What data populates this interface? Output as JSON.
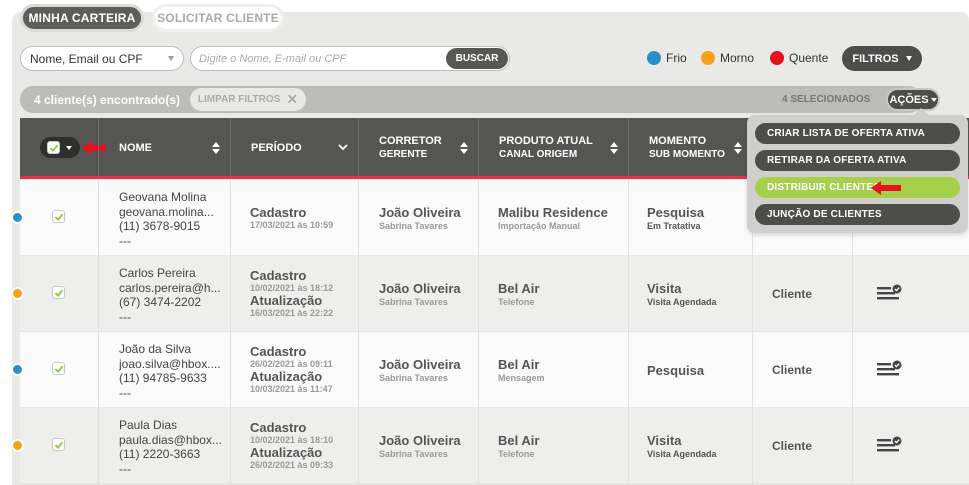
{
  "tabs": [
    {
      "label": "MINHA CARTEIRA",
      "active": true
    },
    {
      "label": "SOLICITAR CLIENTE",
      "active": false
    }
  ],
  "search": {
    "filter_select": "Nome, Email ou CPF",
    "placeholder": "Digite o Nome, E-mail ou CPF",
    "button_label": "BUSCAR"
  },
  "legend": [
    {
      "label": "Frio",
      "color": "#2a8fc7"
    },
    {
      "label": "Morno",
      "color": "#f5a21b"
    },
    {
      "label": "Quente",
      "color": "#e8101f"
    }
  ],
  "filters_label": "FILTROS",
  "status": {
    "count_text": "4 cliente(s) encontrado(s)",
    "clear_filters_label": "LIMPAR FILTROS",
    "selected_text": "4 SELECIONADOS",
    "actions_label": "AÇÕES"
  },
  "columns": {
    "nome": "NOME",
    "periodo": "PERÍODO",
    "corretor": "CORRETOR",
    "corretor_sub": "GERENTE",
    "produto": "PRODUTO ATUAL",
    "produto_sub": "CANAL ORIGEM",
    "momento": "MOMENTO",
    "momento_sub": "SUB MOMENTO"
  },
  "actions_menu": [
    {
      "label": "CRIAR LISTA DE OFERTA ATIVA",
      "highlighted": false
    },
    {
      "label": "RETIRAR DA OFERTA ATIVA",
      "highlighted": false
    },
    {
      "label": "DISTRIBUIR CLIENTES",
      "highlighted": true
    },
    {
      "label": "JUNÇÃO DE CLIENTES",
      "highlighted": false
    }
  ],
  "rows": [
    {
      "temp_color": "#2a8fc7",
      "name": "Geovana Molina",
      "email": "geovana.molina...",
      "phone": "(11) 3678-9015",
      "extra": "---",
      "p1_label": "Cadastro",
      "p1_date": "17/03/2021 às 10:59",
      "p2_label": "",
      "p2_date": "",
      "broker": "João Oliveira",
      "manager": "Sabrina Tavares",
      "product": "Malibu Residence",
      "channel": "Importação Manual",
      "moment": "Pesquisa",
      "submoment": "Em Tratativa",
      "type": ""
    },
    {
      "temp_color": "#f5a21b",
      "name": "Carlos Pereira",
      "email": "carlos.pereira@h...",
      "phone": "(67) 3474-2202",
      "extra": "---",
      "p1_label": "Cadastro",
      "p1_date": "10/02/2021 às 18:12",
      "p2_label": "Atualização",
      "p2_date": "16/03/2021 às 22:22",
      "broker": "João Oliveira",
      "manager": "Sabrina Tavares",
      "product": "Bel Air",
      "channel": "Telefone",
      "moment": "Visita",
      "submoment": "Visita Agendada",
      "type": "Cliente"
    },
    {
      "temp_color": "#2a8fc7",
      "name": "João da Silva",
      "email": "joao.silva@hbox....",
      "phone": "(11) 94785-9633",
      "extra": "---",
      "p1_label": "Cadastro",
      "p1_date": "26/02/2021 às 09:11",
      "p2_label": "Atualização",
      "p2_date": "10/03/2021 às 11:47",
      "broker": "João Oliveira",
      "manager": "Sabrina Tavares",
      "product": "Bel Air",
      "channel": "Mensagem",
      "moment": "Pesquisa",
      "submoment": "",
      "type": "Cliente"
    },
    {
      "temp_color": "#f5a21b",
      "name": "Paula Dias",
      "email": "paula.dias@hbox...",
      "phone": "(11) 2220-3663",
      "extra": "---",
      "p1_label": "Cadastro",
      "p1_date": "10/02/2021 às 18:10",
      "p2_label": "Atualização",
      "p2_date": "26/02/2021 às 09:33",
      "broker": "João Oliveira",
      "manager": "Sabrina Tavares",
      "product": "Bel Air",
      "channel": "Telefone",
      "moment": "Visita",
      "submoment": "Visita Agendada",
      "type": "Cliente"
    }
  ]
}
